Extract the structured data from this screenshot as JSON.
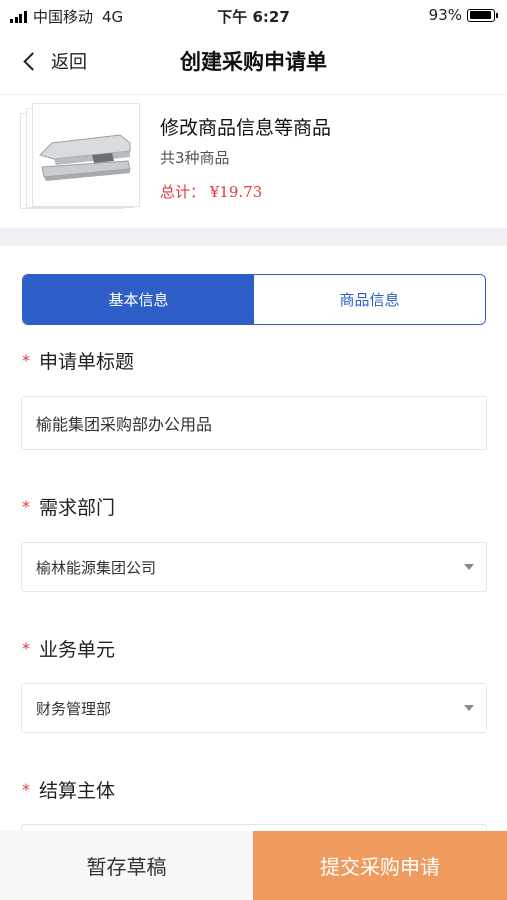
{
  "status_bar": {
    "carrier": "中国移动",
    "network": "4G",
    "time": "下午 6:27",
    "battery_text": "93%",
    "battery_level": 0.93
  },
  "nav": {
    "back_label": "返回",
    "title": "创建采购申请单"
  },
  "product": {
    "name": "修改商品信息等商品",
    "count": "共3种商品",
    "total": "总计： ¥19.73"
  },
  "tabs": [
    {
      "label": "基本信息",
      "active": true
    },
    {
      "label": "商品信息",
      "active": false
    }
  ],
  "form": {
    "title_field": {
      "label": "申请单标题",
      "value": "榆能集团采购部办公用品"
    },
    "department_field": {
      "label": "需求部门",
      "value": "榆林能源集团公司"
    },
    "business_unit_field": {
      "label": "业务单元",
      "value": "财务管理部"
    },
    "settlement_field": {
      "label": "结算主体",
      "value": ""
    },
    "required_mark": "*"
  },
  "actions": {
    "draft_label": "暂存草稿",
    "submit_label": "提交采购申请"
  },
  "colors": {
    "primary": "#2e5fc9",
    "required": "#e03a3a",
    "submit": "#ef9a5f",
    "separator": "#f0f1f4"
  }
}
